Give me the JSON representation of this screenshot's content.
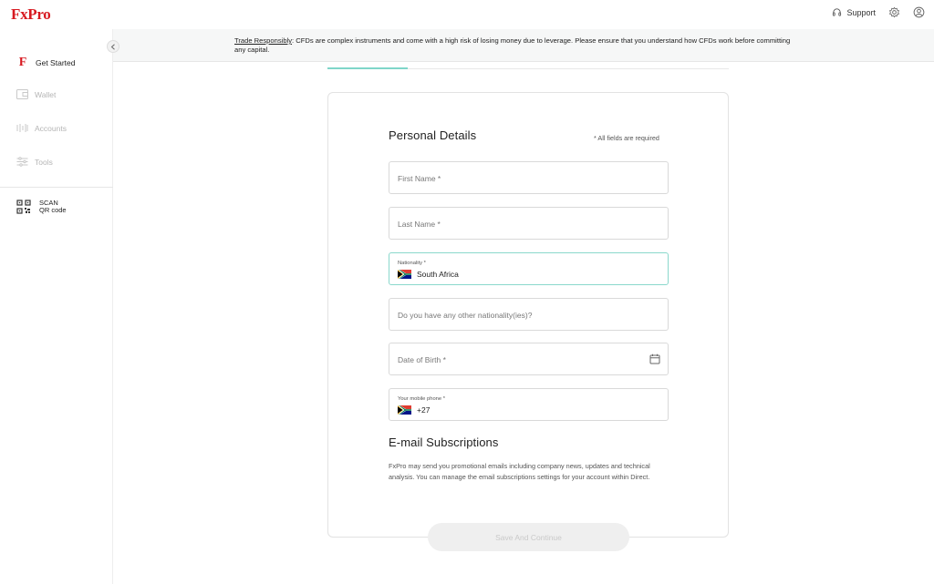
{
  "brand": {
    "logo_text": "FxPro",
    "accent_color": "#d71920"
  },
  "topbar": {
    "support_label": "Support",
    "support_icon": "headset-icon",
    "settings_icon": "gear-icon",
    "profile_icon": "user-circle-icon"
  },
  "sidebar": {
    "items": [
      {
        "label": "Get Started",
        "icon": "fxpro-f-icon",
        "active": true
      },
      {
        "label": "Wallet",
        "icon": "wallet-icon",
        "active": false
      },
      {
        "label": "Accounts",
        "icon": "accounts-icon",
        "active": false
      },
      {
        "label": "Tools",
        "icon": "tools-icon",
        "active": false
      }
    ],
    "scan": {
      "line1": "SCAN",
      "line2": "QR code",
      "icon": "qr-code-icon"
    }
  },
  "banner": {
    "link_text": "Trade Responsibly",
    "text": ": CFDs are complex instruments and come with a high risk of losing money due to leverage. Please ensure that you understand how CFDs work before committing any capital."
  },
  "progress": {
    "fraction": 0.2,
    "color": "#7fd6c9"
  },
  "form": {
    "title": "Personal Details",
    "required_note": "* All fields are required",
    "first_name_placeholder": "First Name *",
    "last_name_placeholder": "Last Name *",
    "nationality": {
      "label": "Nationality *",
      "value": "South Africa",
      "flag": "south-africa-flag"
    },
    "other_nationality_placeholder": "Do you have any other nationality(ies)?",
    "dob_placeholder": "Date of Birth *",
    "phone": {
      "label": "Your mobile phone *",
      "value": "+27",
      "flag": "south-africa-flag"
    }
  },
  "subscriptions": {
    "title": "E-mail Subscriptions",
    "text": "FxPro may send you promotional emails including company news, updates and technical analysis. You can manage the email subscriptions settings for your account within Direct."
  },
  "save_button": {
    "label": "Save And Continue",
    "enabled": false
  }
}
